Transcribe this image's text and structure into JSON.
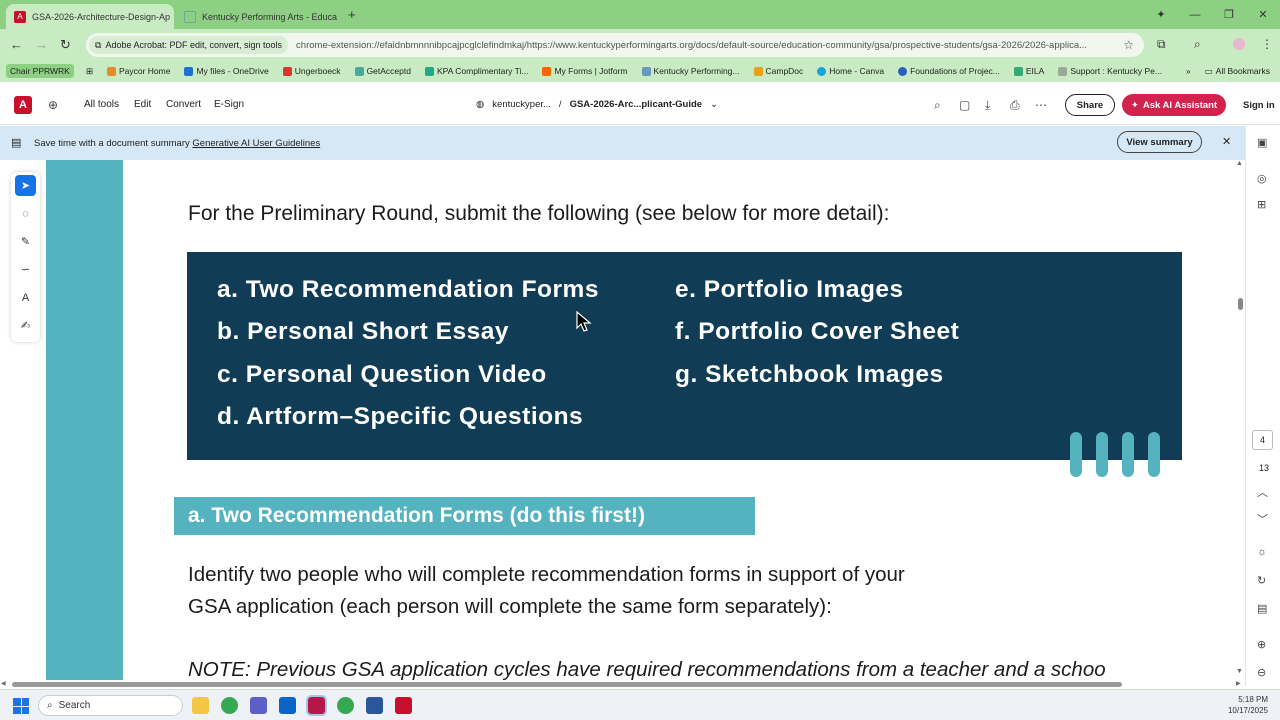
{
  "browser": {
    "tabs": [
      {
        "title": "GSA-2026-Architecture-Design-Ap",
        "active": true
      },
      {
        "title": "Kentucky Performing Arts - Educa",
        "active": false
      }
    ],
    "site_chip": "Adobe Acrobat: PDF edit, convert, sign tools",
    "url": "chrome-extension://efaidnbmnnnibpcajpcglclefindmkaj/https://www.kentuckyperformingarts.org/docs/default-source/education-community/gsa/prospective-students/gsa-2026/2026-applica...",
    "bookmarks": [
      "Chair PPRWRK",
      "Paycor Home",
      "My files - OneDrive",
      "Ungerboeck",
      "GetAcceptd",
      "KPA Complimentary Ti...",
      "My Forms | Jotform",
      "Kentucky Performing...",
      "CampDoc",
      "Home - Canva",
      "Foundations of Projec...",
      "EILA",
      "Support : Kentucky Pe..."
    ],
    "all_bookmarks": "All Bookmarks"
  },
  "acrobat": {
    "menu": [
      "All tools",
      "Edit",
      "Convert",
      "E-Sign"
    ],
    "breadcrumb_site": "kentuckyper...",
    "breadcrumb_sep": "/",
    "breadcrumb_file": "GSA-2026-Arc...plicant-Guide",
    "share": "Share",
    "ai_assistant": "Ask AI Assistant",
    "sign_in": "Sign in"
  },
  "banner": {
    "text": "Save time with a document summary",
    "link": "Generative AI User Guidelines",
    "button": "View summary"
  },
  "document": {
    "intro": "For the Preliminary Round, submit the following (see below for more detail):",
    "requirements_left": [
      "a. Two Recommendation Forms",
      "b. Personal Short Essay",
      "c. Personal Question Video",
      "d. Artform–Specific Questions"
    ],
    "requirements_right": [
      "e. Portfolio Images",
      "f. Portfolio Cover Sheet",
      "g. Sketchbook Images"
    ],
    "section_heading": "a. Two Recommendation Forms (do this first!)",
    "para_line1": "Identify two people who will complete recommendation forms in support of your",
    "para_line2": "GSA application (each person will complete the same form separately):",
    "note": "NOTE: Previous GSA application cycles have required recommendations from a teacher and a schoo"
  },
  "pagination": {
    "current": "4",
    "total": "13"
  },
  "taskbar": {
    "search": "Search",
    "time": "5:18 PM",
    "date": "10/17/2025"
  },
  "colors": {
    "teal": "#55b3bf",
    "navy": "#113c55",
    "acrobat_red": "#c8102e",
    "ai_button": "#d3224e"
  }
}
